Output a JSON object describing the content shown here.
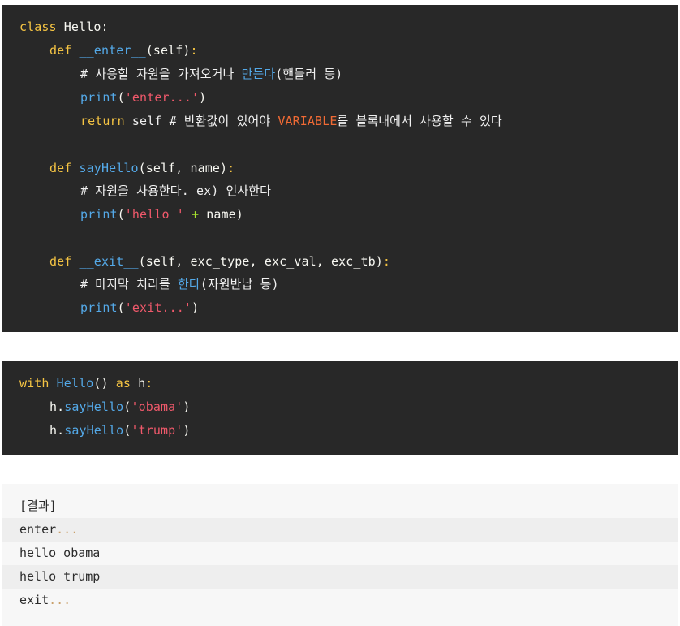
{
  "code_block_1": {
    "line1": {
      "kw": "class",
      "name": "Hello:"
    },
    "line2": {
      "kw": "def",
      "fn": "__enter__",
      "args": "(self)",
      "colon": ":"
    },
    "line3": {
      "comment_a": "# 사용할 자원을 가져오거나 ",
      "highlight": "만든다",
      "comment_b": "(핸들러 등)"
    },
    "line4": {
      "fn": "print",
      "open": "(",
      "str": "'enter...'",
      "close": ")"
    },
    "line5": {
      "kw": "return",
      "rest": " self # 반환값이 있어야 ",
      "highlight": "VARIABLE",
      "rest2": "를 블록내에서 사용할 수 있다"
    },
    "line6": {
      "kw": "def",
      "fn": "sayHello",
      "args": "(self, name)",
      "colon": ":"
    },
    "line7": {
      "comment": "# 자원을 사용한다. ex) 인사한다"
    },
    "line8": {
      "fn": "print",
      "open": "(",
      "str": "'hello '",
      "op": " + ",
      "rest": "name)"
    },
    "line9": {
      "kw": "def",
      "fn": "__exit__",
      "args": "(self, exc_type, exc_val, exc_tb)",
      "colon": ":"
    },
    "line10": {
      "comment_a": "# 마지막 처리를 ",
      "highlight": "한다",
      "comment_b": "(자원반납 등)"
    },
    "line11": {
      "fn": "print",
      "open": "(",
      "str": "'exit...'",
      "close": ")"
    }
  },
  "code_block_2": {
    "line1": {
      "kw": "with",
      "fn": "Hello",
      "parens": "()",
      "kw2": "as",
      "var": "h",
      "colon": ":"
    },
    "line2": {
      "obj": "h.",
      "fn": "sayHello",
      "open": "(",
      "str": "'obama'",
      "close": ")"
    },
    "line3": {
      "obj": "h.",
      "fn": "sayHello",
      "open": "(",
      "str": "'trump'",
      "close": ")"
    }
  },
  "output": {
    "header": "[결과]",
    "lines": [
      {
        "text": "enter",
        "dots": "..."
      },
      {
        "text": "hello obama",
        "dots": ""
      },
      {
        "text": "hello trump",
        "dots": ""
      },
      {
        "text": "exit",
        "dots": "..."
      }
    ]
  },
  "colors": {
    "code_bg": "#282828",
    "keyword": "#f5c443",
    "function": "#54a9e8",
    "string": "#f0596b",
    "variable_highlight": "#f06a34",
    "output_bg": "#f7f7f7"
  }
}
